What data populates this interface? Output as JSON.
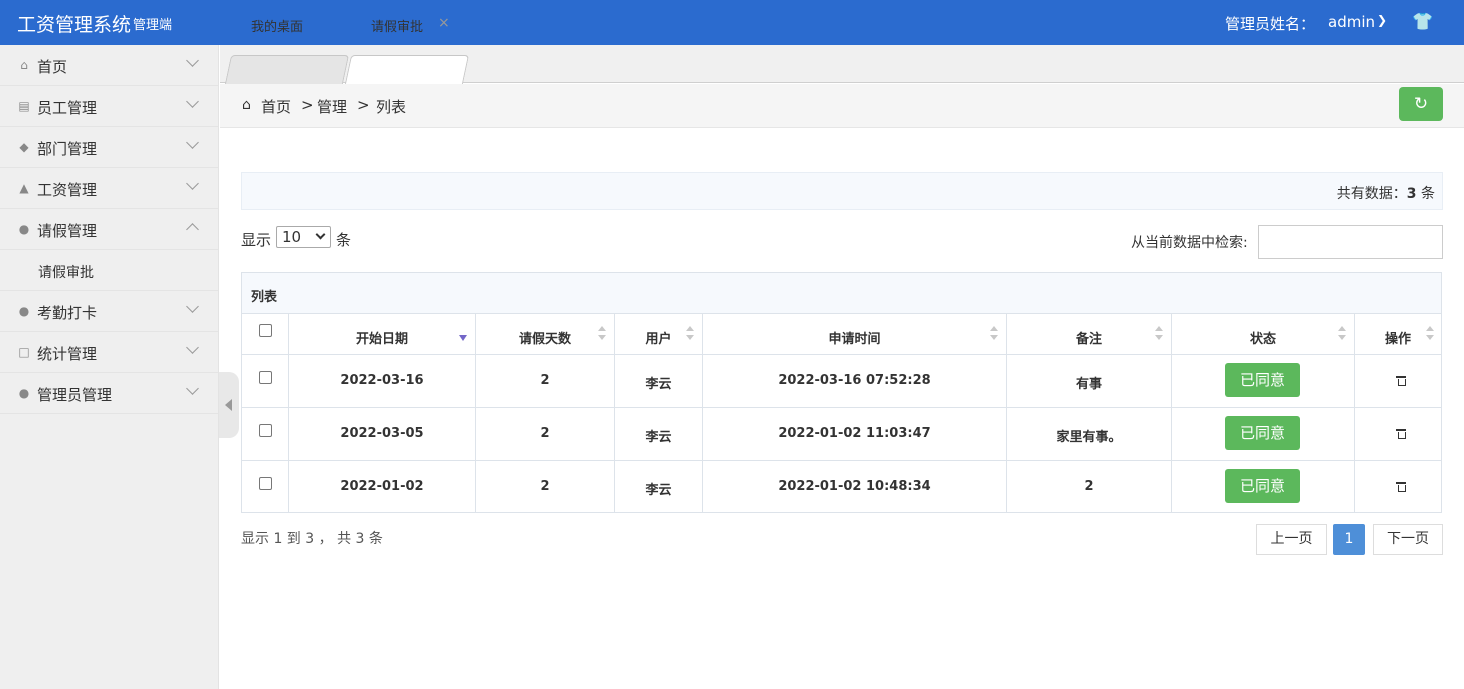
{
  "header": {
    "title": "工资管理系统",
    "subtitle": "管理端",
    "admin_label": "管理员姓名：",
    "admin_name": "admin",
    "shirt_icon": "shirt-icon"
  },
  "sidebar": {
    "items": [
      {
        "label": "首页",
        "icon": "home-icon"
      },
      {
        "label": "员工管理",
        "icon": "clipboard-icon"
      },
      {
        "label": "部门管理",
        "icon": "tree-icon"
      },
      {
        "label": "工资管理",
        "icon": "bank-icon"
      },
      {
        "label": "请假管理",
        "icon": "user-icon",
        "expanded": true
      },
      {
        "label": "考勤打卡",
        "icon": "user-icon"
      },
      {
        "label": "统计管理",
        "icon": "bar-chart-icon"
      },
      {
        "label": "管理员管理",
        "icon": "user-icon"
      }
    ],
    "sub_item": "请假审批"
  },
  "tabs": [
    {
      "label": "我的桌面",
      "active": false
    },
    {
      "label": "请假审批",
      "active": true
    }
  ],
  "breadcrumb": {
    "home": "首页",
    "sep": ">",
    "level2": "管理",
    "level3": "列表"
  },
  "summary": {
    "prefix": "共有数据：",
    "count": "3",
    "suffix": "条"
  },
  "length": {
    "prefix": "显示",
    "value": "10",
    "suffix": "条"
  },
  "search": {
    "label": "从当前数据中检索:",
    "value": ""
  },
  "table": {
    "caption": "列表",
    "columns": [
      "开始日期",
      "请假天数",
      "用户",
      "申请时间",
      "备注",
      "状态",
      "操作"
    ],
    "sort_column": "开始日期",
    "rows": [
      {
        "start": "2022-03-16",
        "days": "2",
        "user": "李云",
        "time": "2022-03-16 07:52:28",
        "remark": "有事",
        "status": "已同意"
      },
      {
        "start": "2022-03-05",
        "days": "2",
        "user": "李云",
        "time": "2022-01-02 11:03:47",
        "remark": "家里有事。",
        "status": "已同意"
      },
      {
        "start": "2022-01-02",
        "days": "2",
        "user": "李云",
        "time": "2022-01-02 10:48:34",
        "remark": "2",
        "status": "已同意"
      }
    ]
  },
  "footer": {
    "info": "显示 1 到 3 ， 共 3 条",
    "prev": "上一页",
    "page": "1",
    "next": "下一页"
  },
  "colors": {
    "header_bg": "#2b6bcf",
    "success": "#5cb85c",
    "page_active": "#4e8fd8"
  }
}
